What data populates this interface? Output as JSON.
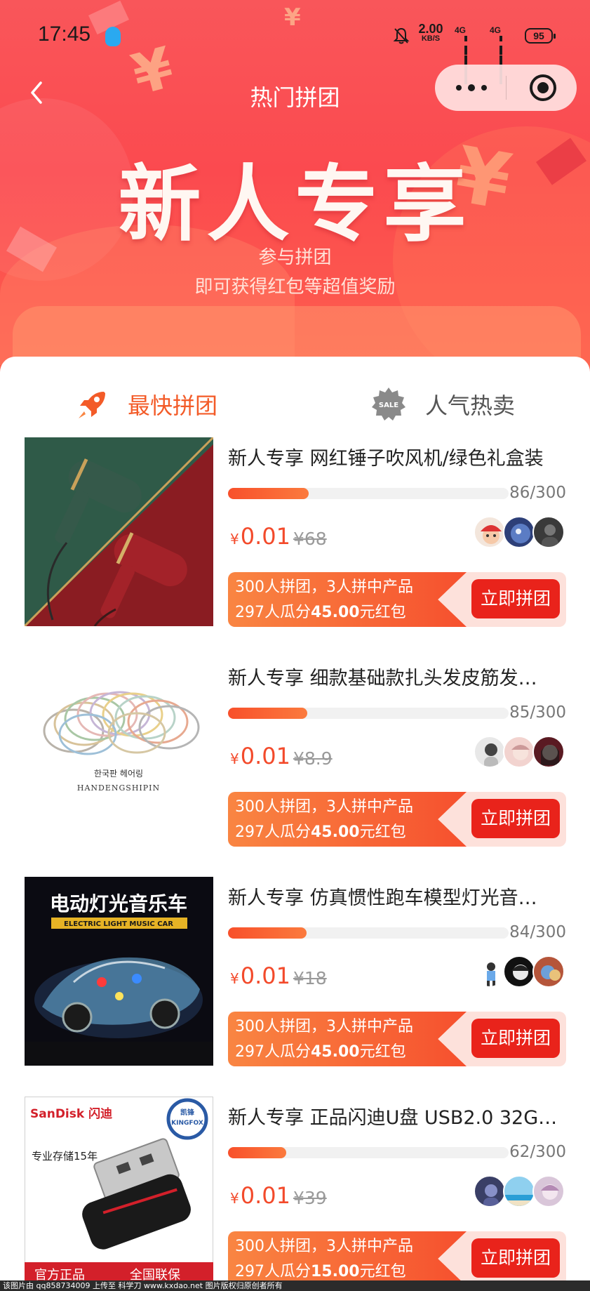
{
  "status_bar": {
    "time": "17:45",
    "net_speed": "2.00",
    "net_unit": "KB/S",
    "signal_1": "4G",
    "signal_2": "4G",
    "battery": "95"
  },
  "nav": {
    "title": "热门拼团"
  },
  "banner": {
    "headline": "新人专享",
    "sub1": "参与拼团",
    "sub2": "即可获得红包等超值奖励"
  },
  "tabs": [
    {
      "label": "最快拼团",
      "active": true,
      "icon": "rocket-icon"
    },
    {
      "label": "人气热卖",
      "active": false,
      "icon": "sale-badge-icon",
      "badge": "SALE"
    }
  ],
  "products": [
    {
      "title": "新人专享 网红锤子吹风机/绿色礼盒装",
      "joined": 86,
      "total": 300,
      "count_text": "86/300",
      "yen": "¥",
      "price": "0.01",
      "orig_price": "¥68",
      "promo_line1": "300人拼团，3人拼中产品",
      "promo_line2_pre": "297人瓜分",
      "promo_amount": "45.00",
      "promo_line2_post": "元红包",
      "button": "立即拼团"
    },
    {
      "title": "新人专享 细款基础款扎头发皮筋发…",
      "joined": 85,
      "total": 300,
      "count_text": "85/300",
      "yen": "¥",
      "price": "0.01",
      "orig_price": "¥8.9",
      "promo_line1": "300人拼团，3人拼中产品",
      "promo_line2_pre": "297人瓜分",
      "promo_amount": "45.00",
      "promo_line2_post": "元红包",
      "button": "立即拼团",
      "image_text_1": "한국판 헤어링",
      "image_text_2": "HANDENGSHIPIN"
    },
    {
      "title": "新人专享 仿真惯性跑车模型灯光音…",
      "joined": 84,
      "total": 300,
      "count_text": "84/300",
      "yen": "¥",
      "price": "0.01",
      "orig_price": "¥18",
      "promo_line1": "300人拼团，3人拼中产品",
      "promo_line2_pre": "297人瓜分",
      "promo_amount": "45.00",
      "promo_line2_post": "元红包",
      "button": "立即拼团",
      "image_text_1": "电动灯光音乐车",
      "image_text_2": "ELECTRIC LIGHT MUSIC CAR"
    },
    {
      "title": "新人专享 正品闪迪U盘 USB2.0 32G…",
      "joined": 62,
      "total": 300,
      "count_text": "62/300",
      "yen": "¥",
      "price": "0.01",
      "orig_price": "¥39",
      "promo_line1": "300人拼团，3人拼中产品",
      "promo_line2_pre": "297人瓜分",
      "promo_amount": "15.00",
      "promo_line2_post": "元红包",
      "button": "立即拼团",
      "image_text_1": "SanDisk 闪迪",
      "image_text_2": "专业存储15年",
      "image_text_3": "凯锋",
      "image_text_4": "KINGFOX",
      "image_text_5": "官方正品",
      "image_text_6": "全国联保"
    }
  ],
  "footer": "该图片由 qq858734009 上传至 科学刀 www.kxdao.net 图片版权归原创者所有",
  "colors": {
    "accent": "#f35b28",
    "price": "#f34a2b",
    "button": "#e9231b",
    "banner": "#fb4a4f"
  }
}
